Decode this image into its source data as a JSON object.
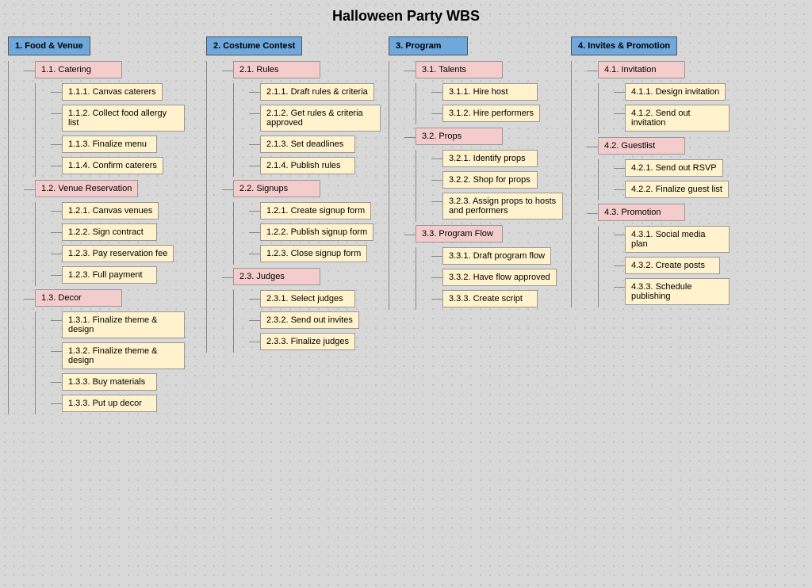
{
  "title": "Halloween Party WBS",
  "columns": [
    {
      "id": "col1",
      "top": "1. Food & Venue",
      "sections": [
        {
          "label": "1.1. Catering",
          "items": [
            "1.1.1. Canvas caterers",
            "1.1.2. Collect food allergy list",
            "1.1.3. Finalize menu",
            "1.1.4. Confirm caterers"
          ]
        },
        {
          "label": "1.2. Venue Reservation",
          "items": [
            "1.2.1. Canvas venues",
            "1.2.2. Sign contract",
            "1.2.3. Pay reservation fee",
            "1.2.3. Full payment"
          ]
        },
        {
          "label": "1.3. Decor",
          "items": [
            "1.3.1. Finalize theme & design",
            "1.3.2. Finalize theme & design",
            "1.3.3. Buy materials",
            "1.3.3. Put up decor"
          ]
        }
      ]
    },
    {
      "id": "col2",
      "top": "2. Costume Contest",
      "sections": [
        {
          "label": "2.1. Rules",
          "items": [
            "2.1.1. Draft rules & criteria",
            "2.1.2. Get rules & criteria approved",
            "2.1.3. Set deadlines",
            "2.1.4. Publish rules"
          ]
        },
        {
          "label": "2.2. Signups",
          "items": [
            "1.2.1. Create signup form",
            "1.2.2. Publish signup form",
            "1.2.3. Close signup form"
          ]
        },
        {
          "label": "2.3. Judges",
          "items": [
            "2.3.1. Select judges",
            "2.3.2. Send out invites",
            "2.3.3. Finalize judges"
          ]
        }
      ]
    },
    {
      "id": "col3",
      "top": "3. Program",
      "sections": [
        {
          "label": "3.1. Talents",
          "items": [
            "3.1.1. Hire host",
            "3.1.2. Hire performers"
          ]
        },
        {
          "label": "3.2. Props",
          "items": [
            "3.2.1. Identify props",
            "3.2.2. Shop for props",
            "3.2.3. Assign props to hosts and performers"
          ]
        },
        {
          "label": "3.3. Program Flow",
          "items": [
            "3.3.1. Draft program flow",
            "3.3.2. Have flow approved",
            "3.3.3. Create script"
          ]
        }
      ]
    },
    {
      "id": "col4",
      "top": "4. Invites & Promotion",
      "sections": [
        {
          "label": "4.1. Invitation",
          "items": [
            "4.1.1. Design invitation",
            "4.1.2. Send out invitation"
          ]
        },
        {
          "label": "4.2. Guestlist",
          "items": [
            "4.2.1. Send out RSVP",
            "4.2.2. Finalize guest list"
          ]
        },
        {
          "label": "4.3. Promotion",
          "items": [
            "4.3.1. Social media plan",
            "4.3.2. Create posts",
            "4.3.3. Schedule publishing"
          ]
        }
      ]
    }
  ]
}
